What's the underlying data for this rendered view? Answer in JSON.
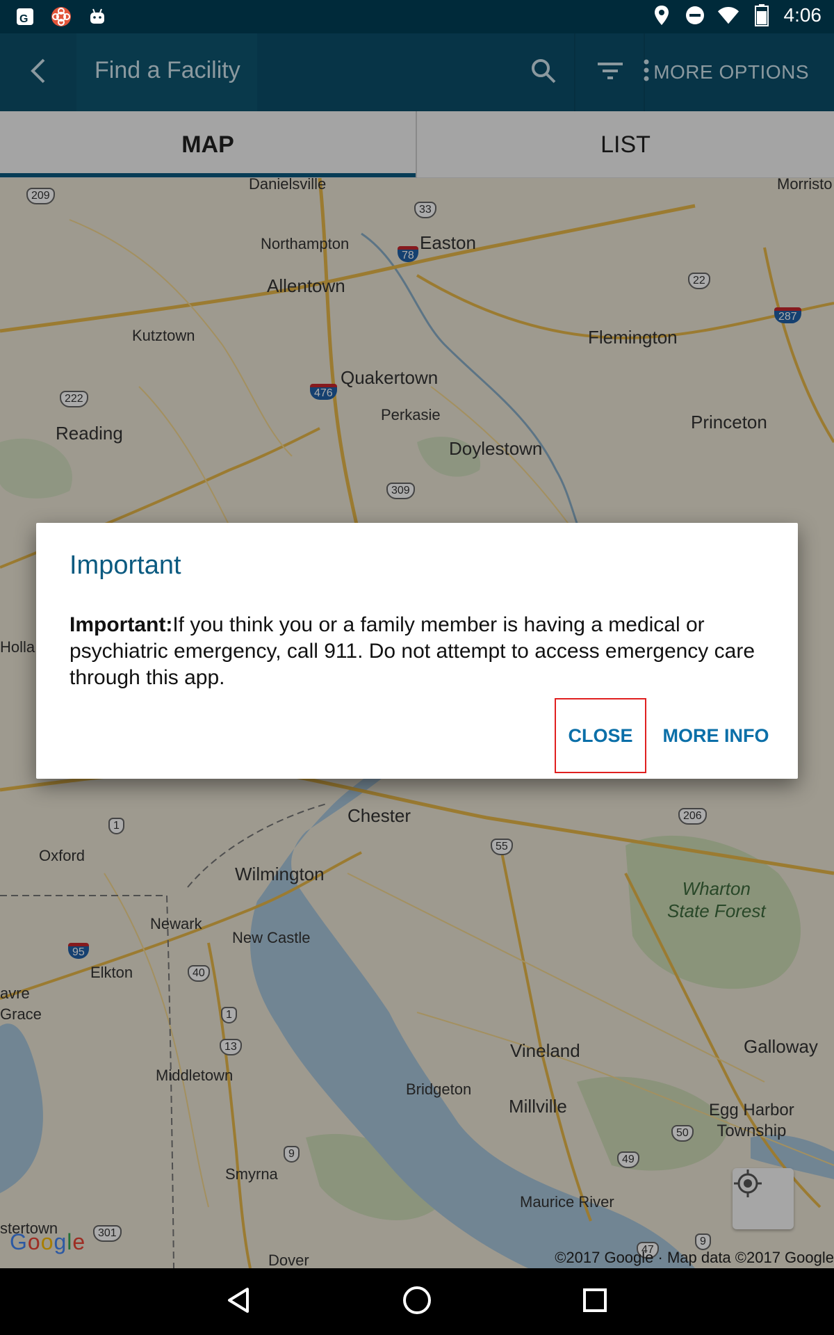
{
  "status_bar": {
    "time": "4:06",
    "left_icons": [
      "maps-notification-icon",
      "app-notification-icon",
      "android-icon"
    ],
    "right_icons": [
      "location-icon",
      "do-not-disturb-icon",
      "wifi-icon",
      "battery-icon"
    ]
  },
  "app_bar": {
    "title": "Find a Facility",
    "more_options_label": "MORE OPTIONS",
    "color": "#0b4e6a"
  },
  "tabs": [
    {
      "label": "MAP",
      "selected": true
    },
    {
      "label": "LIST",
      "selected": false
    }
  ],
  "map": {
    "places": {
      "danielsville": "Danielsville",
      "northampton": "Northampton",
      "easton": "Easton",
      "allentown": "Allentown",
      "morristown": "Morristo",
      "kutztown": "Kutztown",
      "flemington": "Flemington",
      "quakertown": "Quakertown",
      "perkasie": "Perkasie",
      "reading": "Reading",
      "doylestown": "Doylestown",
      "princeton": "Princeton",
      "holland": "Holla",
      "chester": "Chester",
      "oxford": "Oxford",
      "wilmington": "Wilmington",
      "wharton": "Wharton\nState Forest",
      "newark": "Newark",
      "new_castle": "New Castle",
      "elkton": "Elkton",
      "havre_grace_1": "avre",
      "havre_grace_2": "Grace",
      "vineland": "Vineland",
      "galloway": "Galloway",
      "middletown": "Middletown",
      "bridgeton": "Bridgeton",
      "millville": "Millville",
      "egg_harbor": "Egg Harbor\nTownship",
      "smyrna": "Smyrna",
      "maurice_river": "Maurice River",
      "chestertown": "stertown",
      "dover": "Dover"
    },
    "shields": {
      "r209": "209",
      "r33": "33",
      "i78": "78",
      "r22": "22",
      "i287": "287",
      "i476": "476",
      "r222": "222",
      "r309": "309",
      "r206": "206",
      "r1a": "1",
      "r55": "55",
      "i95": "95",
      "r40": "40",
      "r1b": "1",
      "r13": "13",
      "r50": "50",
      "r9a": "9",
      "r49": "49",
      "r301": "301",
      "r47": "47",
      "r9b": "9"
    },
    "google_logo": "Google",
    "attribution": "©2017 Google · Map data ©2017 Google"
  },
  "dialog": {
    "title": "Important",
    "body_bold": "Important:",
    "body_text": "If you think you or a family member is having a medical or psychiatric emergency, call 911. Do not attempt to access emergency care through this app.",
    "close_label": "CLOSE",
    "more_info_label": "MORE INFO",
    "accent": "#0b5a80"
  }
}
